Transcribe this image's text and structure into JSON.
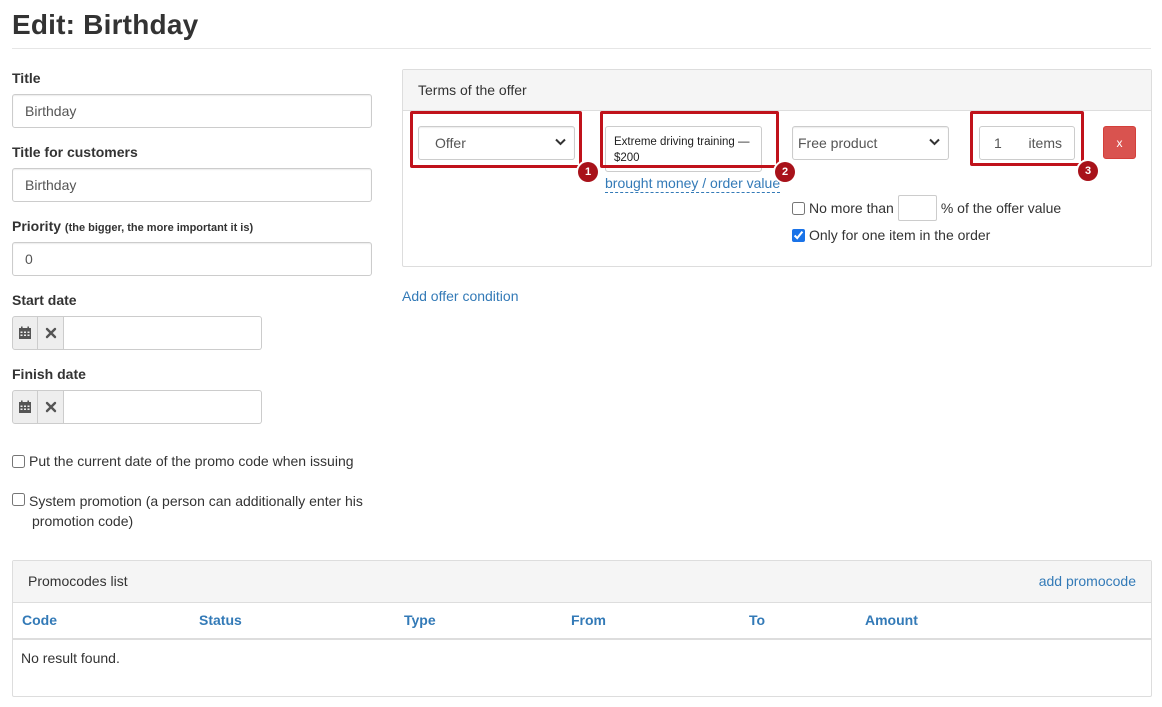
{
  "page": {
    "title": "Edit: Birthday"
  },
  "form": {
    "title_label": "Title",
    "title_value": "Birthday",
    "customer_title_label": "Title for customers",
    "customer_title_value": "Birthday",
    "priority_label": "Priority",
    "priority_hint": "(the bigger, the more important it is)",
    "priority_value": "0",
    "start_date_label": "Start date",
    "finish_date_label": "Finish date",
    "current_date_checkbox": "Put the current date of the promo code when issuing",
    "system_promo_checkbox_line1": "System promotion (a person can additionally enter his",
    "system_promo_checkbox_line2": "promotion code)"
  },
  "terms": {
    "heading": "Terms of the offer",
    "condition_select": "Offer",
    "product_line1": "Extreme driving training —",
    "product_line2": "$200",
    "brought_money_link": "brought money / order value",
    "reward_select": "Free product",
    "quantity_value": "1",
    "quantity_unit": "items",
    "remove_label": "x",
    "no_more_than_label": "No more than",
    "offer_value_suffix": "% of the offer value",
    "one_item_label": "Only for one item in the order",
    "add_condition_link": "Add offer condition",
    "annotations": [
      "1",
      "2",
      "3"
    ]
  },
  "promocodes": {
    "heading": "Promocodes list",
    "add_link": "add promocode",
    "columns": [
      "Code",
      "Status",
      "Type",
      "From",
      "To",
      "Amount"
    ],
    "empty_text": "No result found."
  },
  "colors": {
    "link": "#337ab7",
    "danger": "#d9534f",
    "highlight": "#c0121b"
  }
}
